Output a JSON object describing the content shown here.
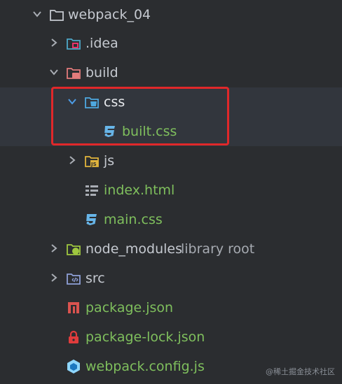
{
  "tree": {
    "root": {
      "label": "webpack_04",
      "icon": "folder-icon",
      "expanded": true
    },
    "items": [
      {
        "label": ".idea",
        "icon": "idea-folder-icon",
        "expanded": false
      },
      {
        "label": "build",
        "icon": "build-folder-icon",
        "expanded": true
      },
      {
        "label": "css",
        "icon": "css-folder-icon",
        "expanded": true,
        "selected": true
      },
      {
        "label": "built.css",
        "icon": "css-file-icon"
      },
      {
        "label": "js",
        "icon": "js-folder-icon",
        "expanded": false
      },
      {
        "label": "index.html",
        "icon": "html-file-icon"
      },
      {
        "label": "main.css",
        "icon": "css-file-icon"
      },
      {
        "label": "node_modules",
        "hint": "library root",
        "icon": "node-modules-folder-icon",
        "expanded": false
      },
      {
        "label": "src",
        "icon": "src-folder-icon",
        "expanded": false
      },
      {
        "label": "package.json",
        "icon": "npm-icon"
      },
      {
        "label": "package-lock.json",
        "icon": "lock-icon"
      },
      {
        "label": "webpack.config.js",
        "icon": "webpack-icon"
      }
    ]
  },
  "watermark": "@稀土掘金技术社区",
  "colors": {
    "background": "#2b2d30",
    "selection": "#32363d",
    "highlight_border": "#e0282a",
    "modified_green": "#7fbf5d"
  }
}
